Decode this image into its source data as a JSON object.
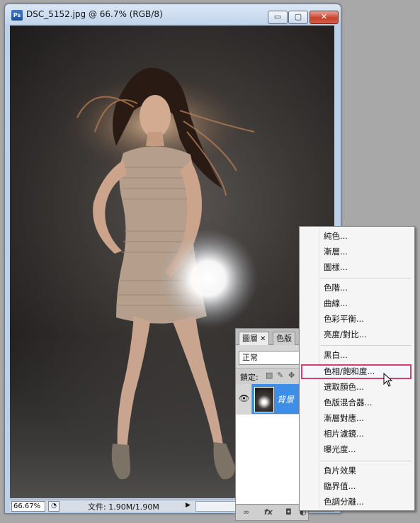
{
  "document_window": {
    "title": "DSC_5152.jpg @ 66.7% (RGB/8)",
    "app_icon_label": "Ps",
    "controls": {
      "minimize": "▭",
      "maximize": "▢",
      "close": "✕"
    },
    "status": {
      "zoom": "66.67%",
      "file_info": "文件: 1.90M/1.90M",
      "arrow": "▶"
    }
  },
  "layers_panel": {
    "tabs": [
      {
        "label": "圖層",
        "close": "✕"
      },
      {
        "label": "色版"
      }
    ],
    "blend_mode": "正常",
    "lock_label": "鎖定:",
    "layer": {
      "name": "背景",
      "visible": true
    },
    "footer_icons": [
      "link-icon",
      "fx-icon",
      "mask-icon",
      "adjustment-icon"
    ]
  },
  "adjustment_menu": {
    "groups": [
      [
        "純色...",
        "漸層...",
        "圖樣..."
      ],
      [
        "色階...",
        "曲線...",
        "色彩平衡...",
        "亮度/對比..."
      ],
      [
        "黑白...",
        "色相/飽和度...",
        "選取顏色...",
        "色版混合器...",
        "漸層對應...",
        "相片濾鏡...",
        "曝光度..."
      ],
      [
        "負片效果",
        "臨界值...",
        "色調分離..."
      ]
    ],
    "highlighted": "色相/飽和度..."
  }
}
